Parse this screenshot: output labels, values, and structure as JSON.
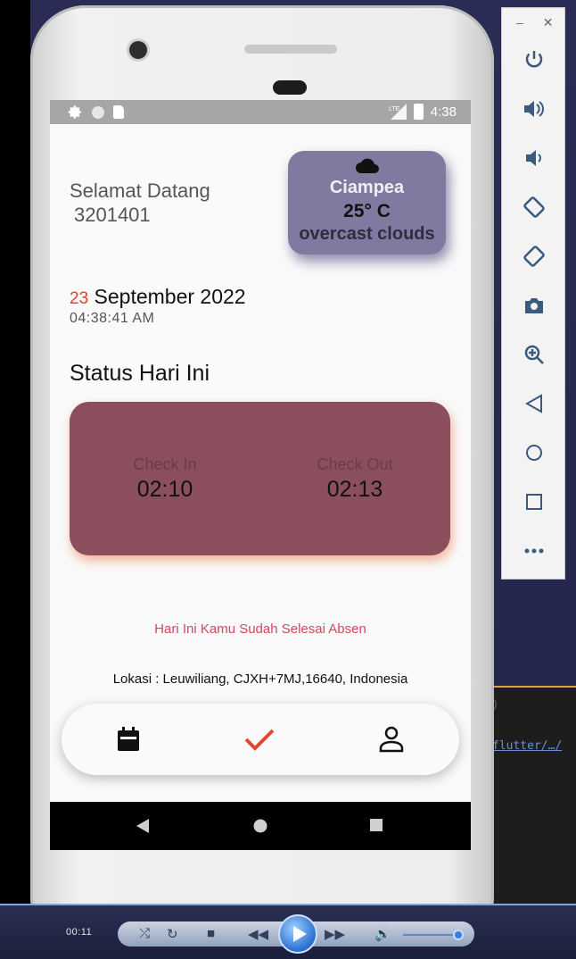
{
  "status_bar": {
    "time": "4:38",
    "network": "LTE"
  },
  "greeting": {
    "line1": "Selamat Datang",
    "user_id": "3201401"
  },
  "weather": {
    "icon": "cloud-icon",
    "city": "Ciampea",
    "temperature": "25° C",
    "description": "overcast clouds"
  },
  "date": {
    "day": "23",
    "month_year": "September 2022",
    "time": "04:38:41 AM"
  },
  "status": {
    "title": "Status Hari Ini",
    "check_in_label": "Check In",
    "check_in_time": "02:10",
    "check_out_label": "Check Out",
    "check_out_time": "02:13"
  },
  "message": "Hari Ini Kamu Sudah Selesai Absen",
  "location": "Lokasi : Leuwiliang, CJXH+7MJ,16640, Indonesia",
  "bottom_nav": {
    "items": [
      "calendar-icon",
      "check-icon",
      "person-icon"
    ],
    "active": "check-icon"
  },
  "ide": {
    "text1": ")",
    "link": "flutter/…/"
  },
  "player": {
    "elapsed": "00:11"
  },
  "colors": {
    "accent": "#d9442b",
    "weather_card": "#807aa1",
    "status_card": "#8a4e5c",
    "message": "#d0475e"
  }
}
